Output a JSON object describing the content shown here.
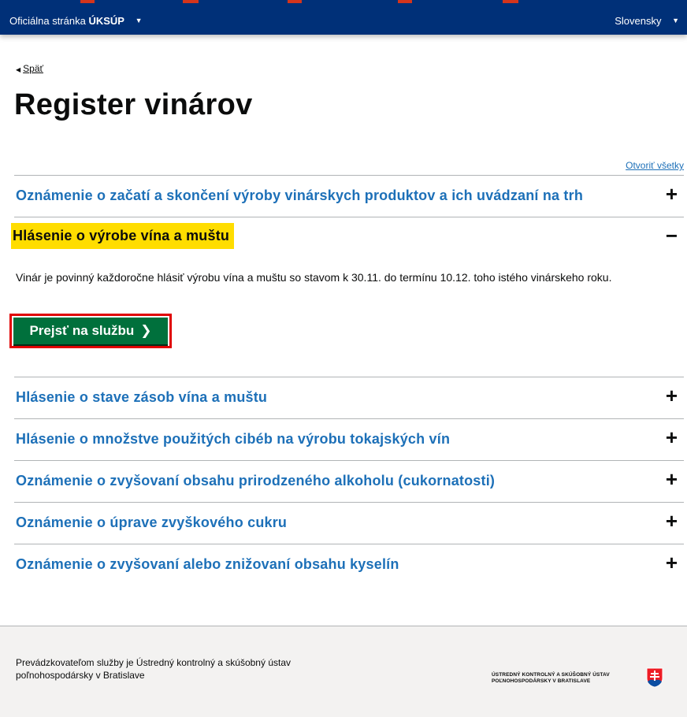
{
  "header": {
    "official_prefix": "Oficiálna stránka",
    "official_brand": "ÚKSÚP",
    "language": "Slovensky"
  },
  "back_label": "Späť",
  "page_title": "Register vinárov",
  "open_all_label": "Otvoriť všetky",
  "accordion": [
    {
      "title": "Oznámenie o začatí a skončení výroby vinárskych produktov a ich uvádzaní na trh",
      "sign": "+"
    },
    {
      "title": "Hlásenie o výrobe vína a muštu",
      "sign": "−",
      "body": "Vinár je povinný každoročne hlásiť výrobu vína a muštu so stavom k 30.11. do termínu 10.12. toho istého vinárskeho roku.",
      "button": "Prejsť na službu"
    },
    {
      "title": "Hlásenie o stave zásob vína a muštu",
      "sign": "+"
    },
    {
      "title": "Hlásenie o množstve použitých cibéb na výrobu tokajských vín",
      "sign": "+"
    },
    {
      "title": "Oznámenie o zvyšovaní obsahu prirodzeného alkoholu (cukornatosti)",
      "sign": "+"
    },
    {
      "title": "Oznámenie o úprave zvyškového cukru",
      "sign": "+"
    },
    {
      "title": "Oznámenie o zvyšovaní alebo znižovaní obsahu kyselín",
      "sign": "+"
    }
  ],
  "footer": {
    "operator_text": "Prevádzkovateľom služby je Ústredný kontrolný a skúšobný ústav poľnohospodársky v Bratislave",
    "org_line1": "ÚSTREDNÝ KONTROLNÝ A SKÚŠOBNÝ ÚSTAV",
    "org_line2": "POĽNOHOSPODÁRSKY V BRATISLAVE"
  },
  "colors": {
    "header_bg": "#003078",
    "link": "#1d70b8",
    "highlight": "#ffdd00",
    "button_green": "#00703c",
    "outline_red": "#e00000"
  },
  "icons": {
    "back": "triangle-left-icon",
    "expand": "plus-icon",
    "collapse": "minus-icon",
    "service_chevron": "chevron-right-icon",
    "emblem": "slovak-coat-of-arms-icon"
  }
}
